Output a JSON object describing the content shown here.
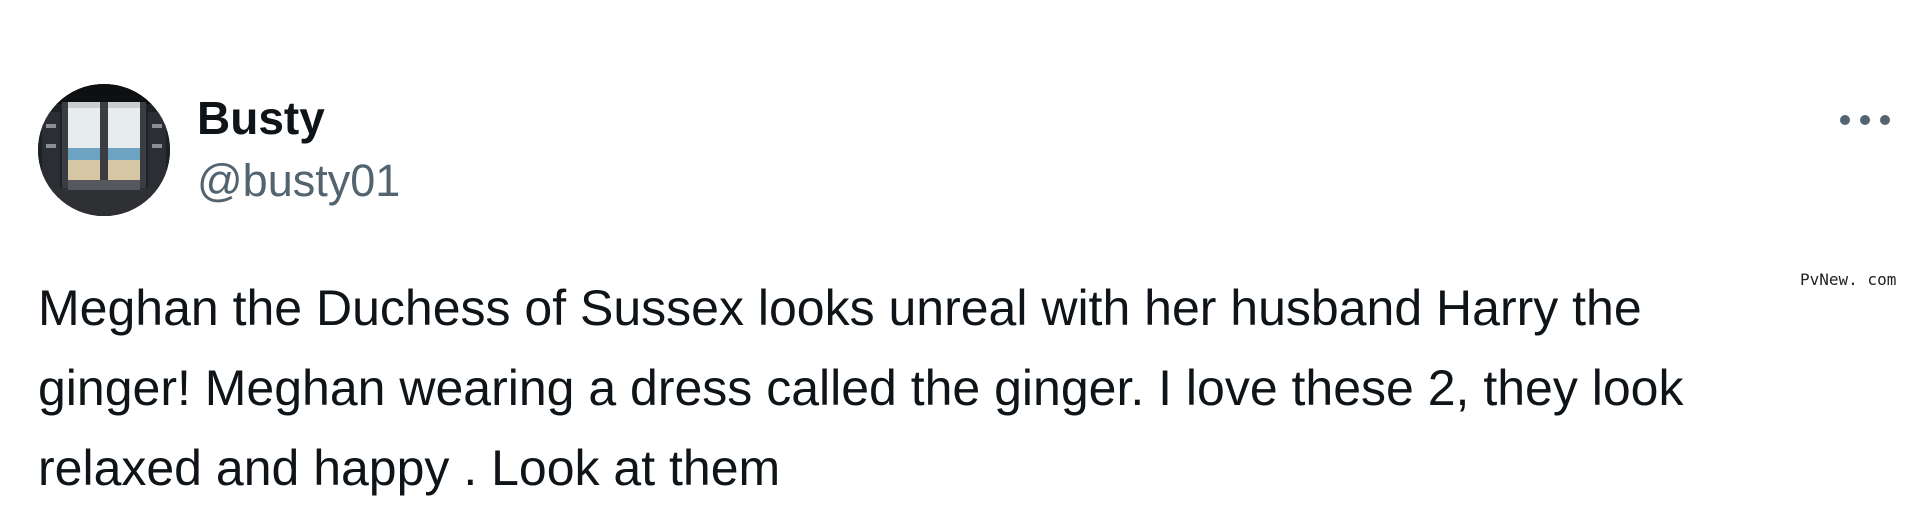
{
  "tweet": {
    "author": {
      "display_name": "Busty",
      "handle": "@busty01",
      "avatar_icon": "avatar-window-view-icon"
    },
    "more_icon": "more-horizontal-icon",
    "text_lines": [
      "Meghan the Duchess of Sussex looks unreal with her husband Harry the",
      "ginger! Meghan wearing a dress called the ginger. I love these 2, they look",
      "relaxed and happy . Look at them"
    ]
  },
  "watermark": "PvNew. com",
  "colors": {
    "text_primary": "#0f1419",
    "text_secondary": "#536471",
    "background": "#ffffff"
  }
}
